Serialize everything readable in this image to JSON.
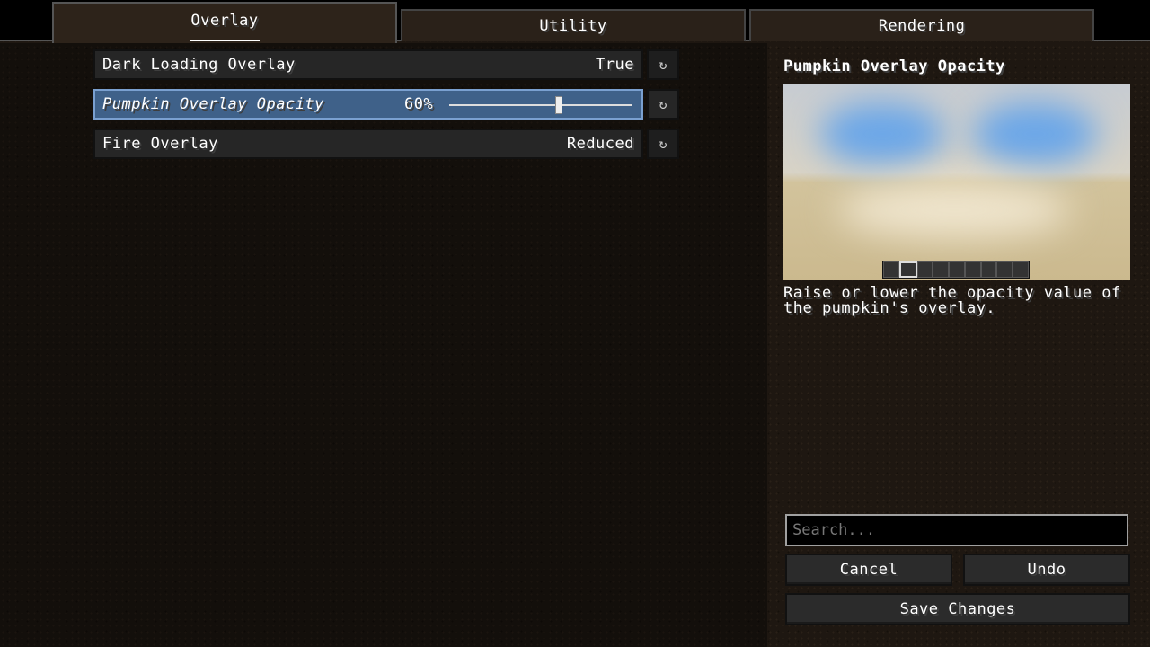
{
  "tabs": [
    {
      "label": "Overlay",
      "active": true
    },
    {
      "label": "Utility"
    },
    {
      "label": "Rendering"
    }
  ],
  "options": [
    {
      "label": "Dark Loading Overlay",
      "value": "True"
    },
    {
      "label": "Pumpkin Overlay Opacity",
      "value": "60%",
      "slider_percent": 60,
      "selected": true
    },
    {
      "label": "Fire Overlay",
      "value": "Reduced"
    }
  ],
  "reset_icon": "reset-arrow-icon",
  "side": {
    "title": "Pumpkin Overlay Opacity",
    "description": "Raise or lower the opacity value of the pumpkin's overlay.",
    "search_placeholder": "Search...",
    "cancel": "Cancel",
    "undo": "Undo",
    "save": "Save Changes"
  },
  "colors": {
    "selected_row": "#3f6189",
    "selected_border": "#7aa0d0"
  }
}
